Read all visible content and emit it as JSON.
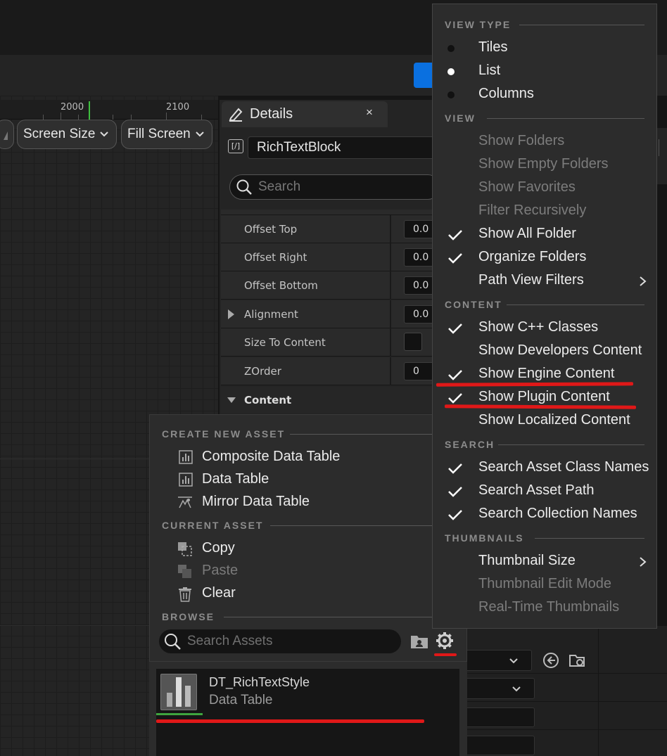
{
  "ruler": {
    "mark1": "2000",
    "mark2": "2100"
  },
  "toolbar": {
    "screen_size": "Screen Size",
    "fill_screen": "Fill Screen"
  },
  "details": {
    "tab_title": "Details",
    "close_glyph": "×",
    "widget_name": "RichTextBlock",
    "widget_icon_glyph": "[/]",
    "search_placeholder": "Search",
    "rows": [
      {
        "label": "Offset Top",
        "value": "0.0"
      },
      {
        "label": "Offset Right",
        "value": "0.0"
      },
      {
        "label": "Offset Bottom",
        "value": "0.0"
      },
      {
        "label": "Alignment",
        "value": "0.0"
      },
      {
        "label": "Size To Content",
        "value": ""
      },
      {
        "label": "ZOrder",
        "value": "0"
      }
    ],
    "content_section": "Content"
  },
  "asset_menu": {
    "create_header": "CREATE NEW ASSET",
    "create_items": [
      "Composite Data Table",
      "Data Table",
      "Mirror Data Table"
    ],
    "current_header": "CURRENT ASSET",
    "copy": "Copy",
    "paste": "Paste",
    "clear": "Clear",
    "browse_header": "BROWSE",
    "search_placeholder": "Search Assets"
  },
  "asset_list": {
    "name": "DT_RichTextStyle",
    "type": "Data Table"
  },
  "view_menu": {
    "view_type_header": "VIEW TYPE",
    "view_types": [
      "Tiles",
      "List",
      "Columns"
    ],
    "selected_view_type": "List",
    "view_header": "VIEW",
    "view_items": [
      {
        "label": "Show Folders",
        "checked": false,
        "enabled": false
      },
      {
        "label": "Show Empty Folders",
        "checked": false,
        "enabled": false
      },
      {
        "label": "Show Favorites",
        "checked": false,
        "enabled": false
      },
      {
        "label": "Filter Recursively",
        "checked": false,
        "enabled": false
      },
      {
        "label": "Show All Folder",
        "checked": true,
        "enabled": true
      },
      {
        "label": "Organize Folders",
        "checked": true,
        "enabled": true
      },
      {
        "label": "Path View Filters",
        "checked": false,
        "enabled": true,
        "submenu": true
      }
    ],
    "content_header": "CONTENT",
    "content_items": [
      {
        "label": "Show C++ Classes",
        "checked": true
      },
      {
        "label": "Show Developers Content",
        "checked": false
      },
      {
        "label": "Show Engine Content",
        "checked": true
      },
      {
        "label": "Show Plugin Content",
        "checked": true
      },
      {
        "label": "Show Localized Content",
        "checked": false
      }
    ],
    "search_header": "SEARCH",
    "search_items": [
      {
        "label": "Search Asset Class Names",
        "checked": true
      },
      {
        "label": "Search Asset Path",
        "checked": true
      },
      {
        "label": "Search Collection Names",
        "checked": true
      }
    ],
    "thumbnails_header": "THUMBNAILS",
    "thumbnail_items": [
      {
        "label": "Thumbnail Size",
        "enabled": true,
        "submenu": true
      },
      {
        "label": "Thumbnail Edit Mode",
        "enabled": false
      },
      {
        "label": "Real-Time Thumbnails",
        "enabled": false
      }
    ]
  },
  "colors": {
    "accent_blue": "#0a70e0",
    "annotation_red": "#e01818",
    "asset_green": "#3fa53f"
  }
}
